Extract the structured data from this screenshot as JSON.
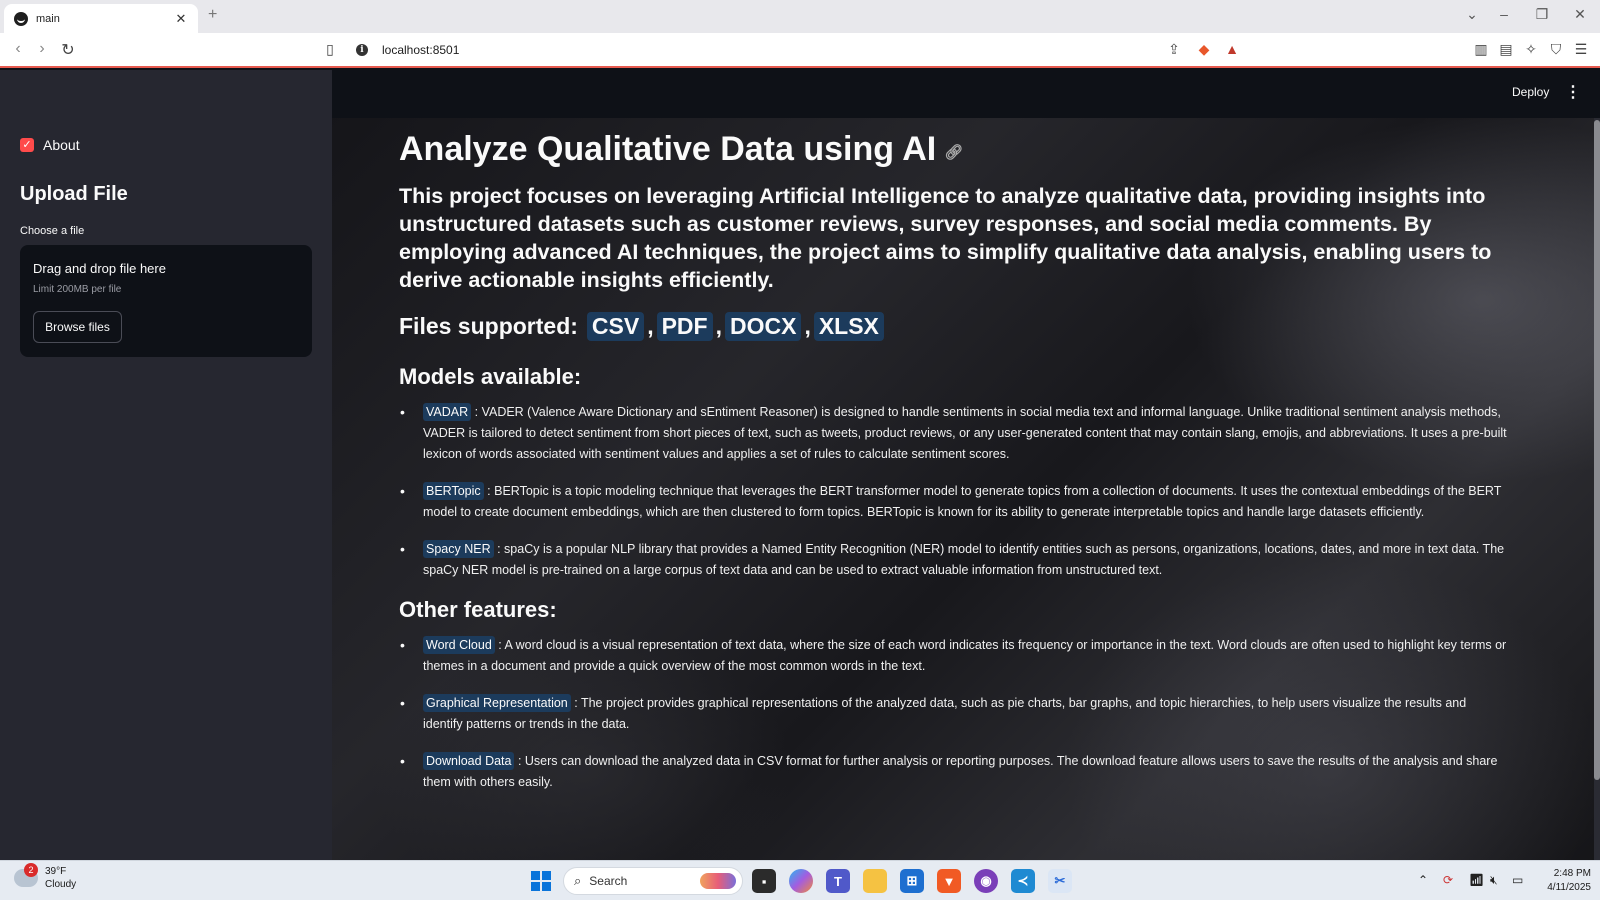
{
  "browser": {
    "tab_title": "main",
    "url": "localhost:8501"
  },
  "sidebar": {
    "about_label": "About",
    "upload_title": "Upload File",
    "choose_label": "Choose a file",
    "drop_title": "Drag and drop file here",
    "drop_limit": "Limit 200MB per file",
    "browse_label": "Browse files"
  },
  "header": {
    "deploy_label": "Deploy"
  },
  "main": {
    "title": "Analyze Qualitative Data using AI",
    "intro": "This project focuses on leveraging Artificial Intelligence to analyze qualitative data, providing insights into unstructured datasets such as customer reviews, survey responses, and social media comments. By employing advanced AI techniques, the project aims to simplify qualitative data analysis, enabling users to derive actionable insights efficiently.",
    "files_label": "Files supported:",
    "file_types": [
      "CSV",
      "PDF",
      "DOCX",
      "XLSX"
    ],
    "models_heading": "Models available:",
    "models": [
      {
        "name": "VADAR",
        "desc": ": VADER (Valence Aware Dictionary and sEntiment Reasoner) is designed to handle sentiments in social media text and informal language. Unlike traditional sentiment analysis methods, VADER is tailored to detect sentiment from short pieces of text, such as tweets, product reviews, or any user-generated content that may contain slang, emojis, and abbreviations. It uses a pre-built lexicon of words associated with sentiment values and applies a set of rules to calculate sentiment scores."
      },
      {
        "name": "BERTopic",
        "desc": ": BERTopic is a topic modeling technique that leverages the BERT transformer model to generate topics from a collection of documents. It uses the contextual embeddings of the BERT model to create document embeddings, which are then clustered to form topics. BERTopic is known for its ability to generate interpretable topics and handle large datasets efficiently."
      },
      {
        "name": "Spacy NER",
        "desc": ": spaCy is a popular NLP library that provides a Named Entity Recognition (NER) model to identify entities such as persons, organizations, locations, dates, and more in text data. The spaCy NER model is pre-trained on a large corpus of text data and can be used to extract valuable information from unstructured text."
      }
    ],
    "features_heading": "Other features:",
    "features": [
      {
        "name": "Word Cloud",
        "desc": ": A word cloud is a visual representation of text data, where the size of each word indicates its frequency or importance in the text. Word clouds are often used to highlight key terms or themes in a document and provide a quick overview of the most common words in the text."
      },
      {
        "name": "Graphical Representation",
        "desc": ": The project provides graphical representations of the analyzed data, such as pie charts, bar graphs, and topic hierarchies, to help users visualize the results and identify patterns or trends in the data."
      },
      {
        "name": "Download Data",
        "desc": ": Users can download the analyzed data in CSV format for further analysis or reporting purposes. The download feature allows users to save the results of the analysis and share them with others easily."
      }
    ]
  },
  "taskbar": {
    "weather_badge": "2",
    "temperature": "39°F",
    "condition": "Cloudy",
    "search_placeholder": "Search",
    "time": "2:48 PM",
    "date": "4/11/2025"
  },
  "colors": {
    "accent": "#ff4b4b",
    "chip_bg": "#1c3b5c",
    "sidebar_bg": "#262730",
    "app_bg": "#0e1117"
  }
}
